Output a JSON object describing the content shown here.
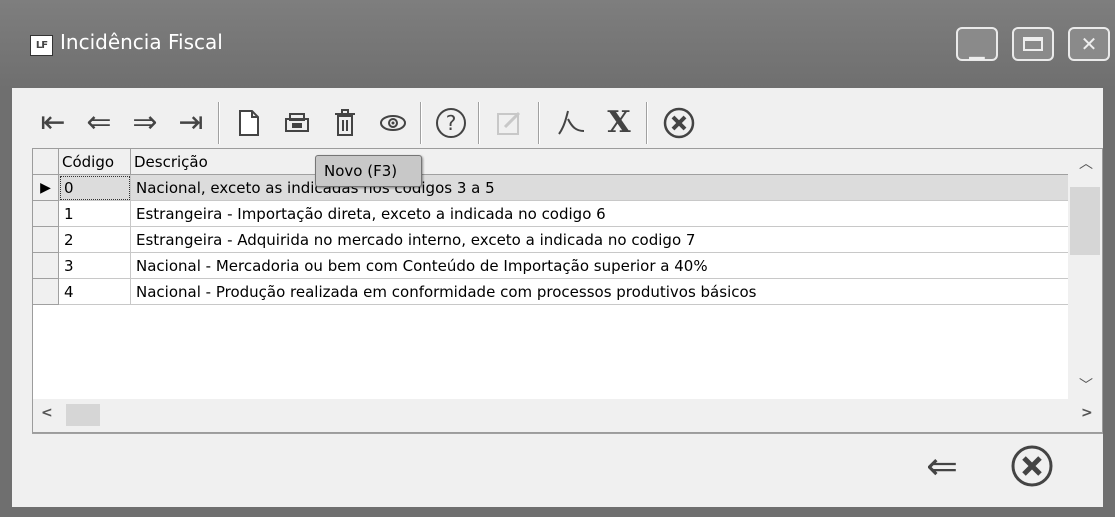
{
  "window": {
    "icon_text": "LF",
    "title": "Incidência Fiscal"
  },
  "toolbar": {
    "buttons": [
      {
        "name": "first-record",
        "glyph": "⇤",
        "enabled": true
      },
      {
        "name": "previous-record",
        "glyph": "⇐",
        "enabled": true
      },
      {
        "name": "next-record",
        "glyph": "⇒",
        "enabled": true
      },
      {
        "name": "last-record",
        "glyph": "⇥",
        "enabled": true
      },
      {
        "name": "new-record",
        "glyph": "🗋",
        "enabled": true
      },
      {
        "name": "print-record",
        "glyph": "🖶",
        "enabled": true
      },
      {
        "name": "delete-record",
        "glyph": "🗑",
        "enabled": true
      },
      {
        "name": "view-record",
        "glyph": "◉",
        "enabled": true
      },
      {
        "name": "help",
        "glyph": "?",
        "enabled": true
      },
      {
        "name": "edit-record",
        "glyph": "✎",
        "enabled": false
      },
      {
        "name": "export-pdf",
        "glyph": "⅄",
        "enabled": true
      },
      {
        "name": "export-excel",
        "glyph": "X",
        "enabled": true
      },
      {
        "name": "close-form",
        "glyph": "✖",
        "enabled": true
      }
    ]
  },
  "tooltip": "Novo (F3)",
  "table": {
    "columns": [
      "Código",
      "Descrição"
    ],
    "rows": [
      {
        "code": "0",
        "description": "Nacional, exceto as indicadas nos codigos 3 a 5",
        "selected": true
      },
      {
        "code": "1",
        "description": "Estrangeira - Importação direta, exceto a indicada no codigo 6",
        "selected": false
      },
      {
        "code": "2",
        "description": "Estrangeira - Adquirida no mercado interno, exceto a indicada no codigo 7",
        "selected": false
      },
      {
        "code": "3",
        "description": "Nacional - Mercadoria ou bem com Conteúdo de Importação superior a 40%",
        "selected": false
      },
      {
        "code": "4",
        "description": "Nacional - Produção realizada em conformidade com processos produtivos básicos",
        "selected": false
      }
    ]
  },
  "footer": {
    "back_glyph": "⇐",
    "close_glyph": "✖"
  },
  "colors": {
    "titlebar": "#6f6f6f",
    "selected_row": "#dcdcdc",
    "tooltip": "#c8c8c8"
  }
}
